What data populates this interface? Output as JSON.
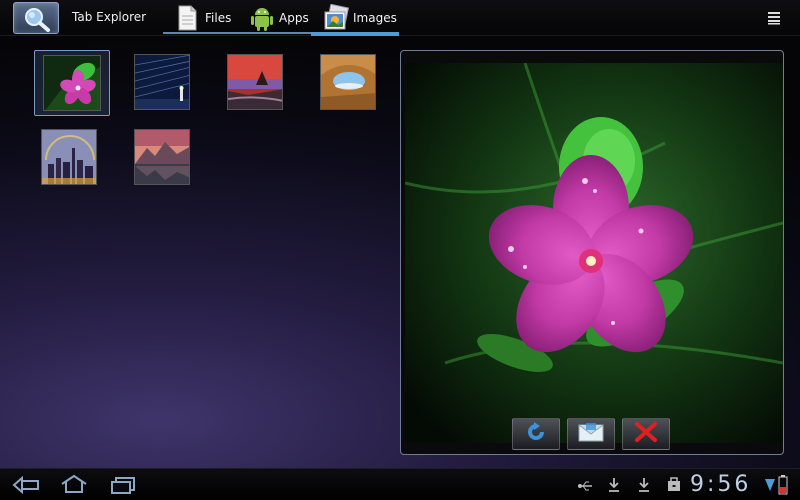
{
  "app": {
    "title": "Tab Explorer",
    "icon": "magnifier-icon"
  },
  "tabs": [
    {
      "label": "Files",
      "icon": "document-icon",
      "selected": false
    },
    {
      "label": "Apps",
      "icon": "android-icon",
      "selected": false
    },
    {
      "label": "Images",
      "icon": "images-icon",
      "selected": true
    }
  ],
  "menu": {
    "icon": "overflow-menu-icon"
  },
  "thumbnails": [
    {
      "subject": "pink-flower",
      "selected": true
    },
    {
      "subject": "star-trails-lighthouse",
      "selected": false
    },
    {
      "subject": "sea-stack-sunset",
      "selected": false
    },
    {
      "subject": "rock-arch",
      "selected": false
    },
    {
      "subject": "city-skyline-rainbow",
      "selected": false
    },
    {
      "subject": "mountain-lake-dusk",
      "selected": false
    }
  ],
  "preview": {
    "subject": "pink-flower",
    "actions": [
      {
        "icon": "rotate-icon"
      },
      {
        "icon": "email-icon"
      },
      {
        "icon": "delete-icon"
      }
    ]
  },
  "colors": {
    "accent": "#4f9bd8",
    "flower": "#d448b8",
    "leaf": "#3fbf3f"
  },
  "system_bar": {
    "time": "9:56",
    "nav": [
      "back-icon",
      "home-icon",
      "recent-apps-icon"
    ],
    "status": [
      "usb-icon",
      "download-icon",
      "download-icon-2",
      "briefcase-icon",
      "signal-icon",
      "battery-icon"
    ]
  }
}
